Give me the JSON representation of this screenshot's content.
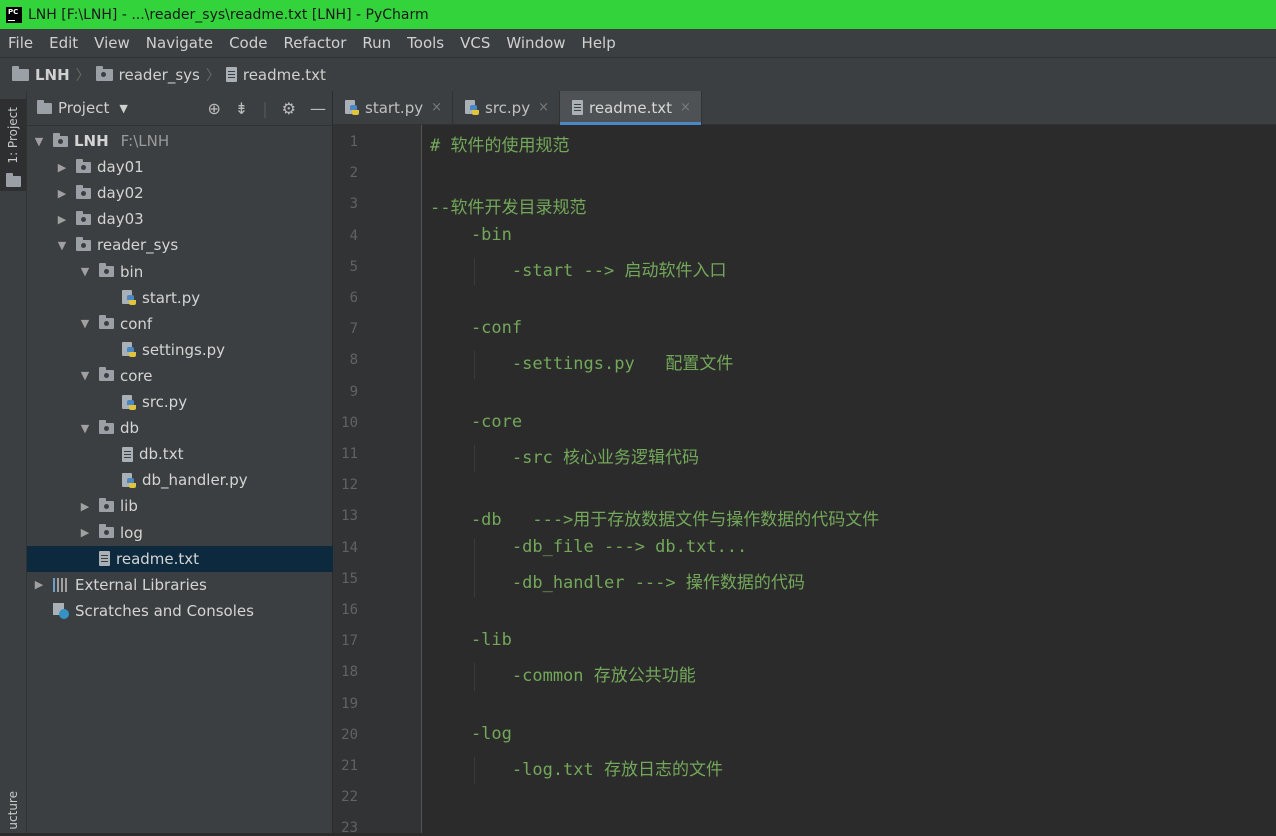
{
  "window": {
    "title": "LNH [F:\\LNH] - ...\\reader_sys\\readme.txt [LNH] - PyCharm",
    "logo_text": "PC"
  },
  "menu": [
    "File",
    "Edit",
    "View",
    "Navigate",
    "Code",
    "Refactor",
    "Run",
    "Tools",
    "VCS",
    "Window",
    "Help"
  ],
  "breadcrumb": [
    "LNH",
    "reader_sys",
    "readme.txt"
  ],
  "left_strip": {
    "project_tab": "1: Project",
    "structure_tab": "ucture"
  },
  "project_panel": {
    "title": "Project",
    "tree": [
      {
        "label": "LNH",
        "path": "F:\\LNH",
        "kind": "folder",
        "depth": 0,
        "expanded": true
      },
      {
        "label": "day01",
        "kind": "folder",
        "depth": 1,
        "expanded": false
      },
      {
        "label": "day02",
        "kind": "folder",
        "depth": 1,
        "expanded": false
      },
      {
        "label": "day03",
        "kind": "folder",
        "depth": 1,
        "expanded": false
      },
      {
        "label": "reader_sys",
        "kind": "folder",
        "depth": 1,
        "expanded": true
      },
      {
        "label": "bin",
        "kind": "folder",
        "depth": 2,
        "expanded": true
      },
      {
        "label": "start.py",
        "kind": "py",
        "depth": 3
      },
      {
        "label": "conf",
        "kind": "folder",
        "depth": 2,
        "expanded": true
      },
      {
        "label": "settings.py",
        "kind": "py",
        "depth": 3
      },
      {
        "label": "core",
        "kind": "folder",
        "depth": 2,
        "expanded": true
      },
      {
        "label": "src.py",
        "kind": "py",
        "depth": 3
      },
      {
        "label": "db",
        "kind": "folder",
        "depth": 2,
        "expanded": true
      },
      {
        "label": "db.txt",
        "kind": "txt",
        "depth": 3
      },
      {
        "label": "db_handler.py",
        "kind": "py",
        "depth": 3
      },
      {
        "label": "lib",
        "kind": "folder",
        "depth": 2,
        "expanded": false
      },
      {
        "label": "log",
        "kind": "folder",
        "depth": 2,
        "expanded": false
      },
      {
        "label": "readme.txt",
        "kind": "txt",
        "depth": 2,
        "selected": true
      },
      {
        "label": "External Libraries",
        "kind": "lib",
        "depth": 0,
        "expanded": false
      },
      {
        "label": "Scratches and Consoles",
        "kind": "scratch",
        "depth": 0
      }
    ]
  },
  "editor": {
    "tabs": [
      {
        "label": "start.py",
        "kind": "py",
        "active": false
      },
      {
        "label": "src.py",
        "kind": "py",
        "active": false
      },
      {
        "label": "readme.txt",
        "kind": "txt",
        "active": true
      }
    ],
    "lines": [
      "# 软件的使用规范",
      "",
      "--软件开发目录规范",
      "    -bin",
      "        -start --> 启动软件入口",
      "",
      "    -conf",
      "        -settings.py   配置文件",
      "",
      "    -core",
      "        -src 核心业务逻辑代码",
      "",
      "    -db   --->用于存放数据文件与操作数据的代码文件",
      "        -db_file ---> db.txt...",
      "        -db_handler ---> 操作数据的代码",
      "",
      "    -lib",
      "        -common 存放公共功能",
      "",
      "    -log",
      "        -log.txt 存放日志的文件",
      "",
      ""
    ]
  },
  "colors": {
    "title_bar": "#33d33c",
    "code_text": "#73a85a",
    "selection": "#0d293e",
    "tab_underline": "#4a88c7"
  }
}
